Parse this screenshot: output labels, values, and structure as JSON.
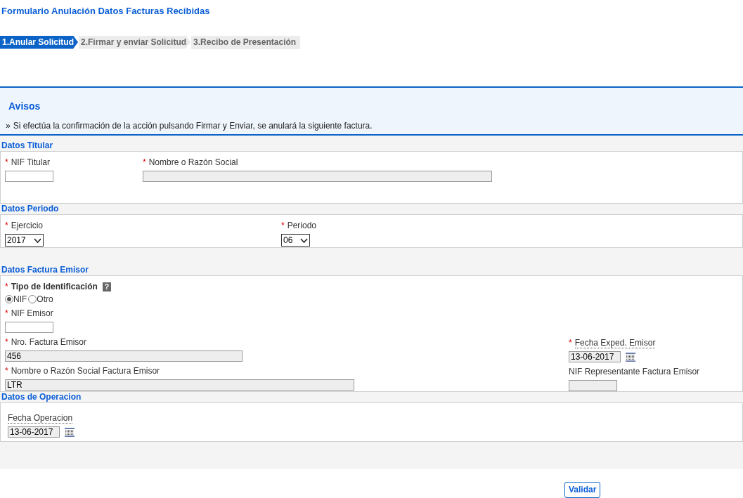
{
  "title": "Formulario Anulación Datos Facturas Recibidas",
  "steps": [
    {
      "label": "1.Anular Solicitud",
      "selected": true
    },
    {
      "label": "2.Firmar y enviar Solicitud",
      "selected": false
    },
    {
      "label": "3.Recibo de Presentación",
      "selected": false
    }
  ],
  "notice": {
    "title": "Avisos",
    "bullet": "»",
    "text": "Si efectúa la confirmación de la acción pulsando Firmar y Enviar, se anulará la siguiente factura."
  },
  "titular": {
    "heading": "Datos Titular",
    "fields": [
      {
        "marker": "*",
        "label": "NIF Titular",
        "kind": "text",
        "disabled": false
      },
      {
        "marker": "*",
        "label": "Nombre o Razón Social",
        "kind": "text",
        "disabled": true
      }
    ]
  },
  "periodo": {
    "heading": "Datos Periodo",
    "fields": [
      {
        "marker": "*",
        "label": "Ejercicio",
        "kind": "select",
        "value": "2017"
      },
      {
        "marker": "*",
        "label": "Periodo",
        "kind": "select",
        "value": "06"
      }
    ]
  },
  "emisor": {
    "heading": "Datos Factura Emisor",
    "id_type": {
      "marker": "*",
      "label": "Tipo de Identificación",
      "help": "?",
      "options": [
        {
          "label": "NIF",
          "selected": true
        },
        {
          "label": "Otro",
          "selected": false
        }
      ]
    },
    "left": [
      {
        "marker": "*",
        "label": "NIF Emisor",
        "kind": "text",
        "disabled": false
      },
      {
        "marker": "*",
        "label": "Nro. Factura Emisor",
        "kind": "text",
        "value": "456",
        "disabled": true
      },
      {
        "marker": "*",
        "label": "Nombre o Razón Social Factura Emisor",
        "kind": "text",
        "value": "LTR",
        "disabled": true
      }
    ],
    "right": [
      {
        "marker": "*",
        "label": "Fecha Exped. Emisor",
        "kind": "date",
        "value": "13-06-2017",
        "disabled": true
      },
      {
        "label": "NIF Representante Factura Emisor",
        "kind": "text",
        "disabled": true
      }
    ]
  },
  "operacion": {
    "heading": "Datos de Operacion",
    "fields": [
      {
        "label": "Fecha Operacion",
        "kind": "date",
        "value": "13-06-2017",
        "disabled": true
      }
    ]
  },
  "submit": "Validar"
}
